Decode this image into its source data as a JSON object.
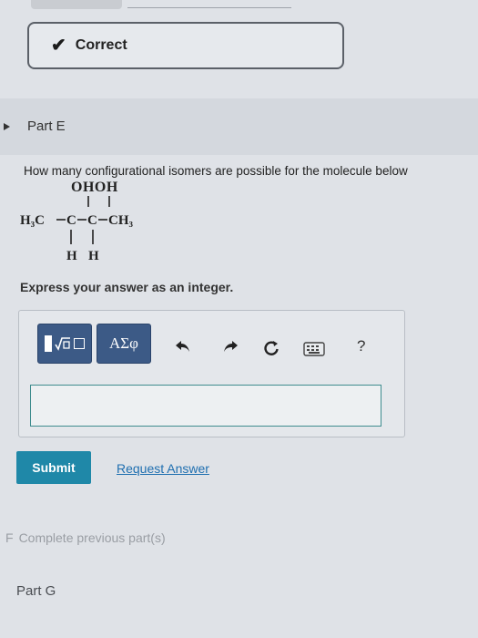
{
  "status": {
    "icon": "check-icon",
    "label": "Correct"
  },
  "part_e": {
    "title": "Part E",
    "question": "How many configurational isomers are possible for the molecule below",
    "molecule": {
      "top_groups": "OHOH",
      "main_chain": {
        "left": "H₃C",
        "c1": "C",
        "c2": "C",
        "right": "CH₃"
      },
      "bottom_h1": "H",
      "bottom_h2": "H"
    },
    "instruction": "Express your answer as an integer.",
    "toolbar": {
      "templates_icon": "templates-icon",
      "symbols_label": "ΑΣφ",
      "undo_icon": "undo-icon",
      "redo_icon": "redo-icon",
      "reset_icon": "reset-icon",
      "keyboard_icon": "keyboard-icon",
      "help_label": "?"
    },
    "answer": {
      "value": ""
    },
    "submit_label": "Submit",
    "request_answer_label": "Request Answer"
  },
  "part_f": {
    "letter": "F",
    "message": "Complete previous part(s)"
  },
  "part_g": {
    "title": "Part G"
  }
}
